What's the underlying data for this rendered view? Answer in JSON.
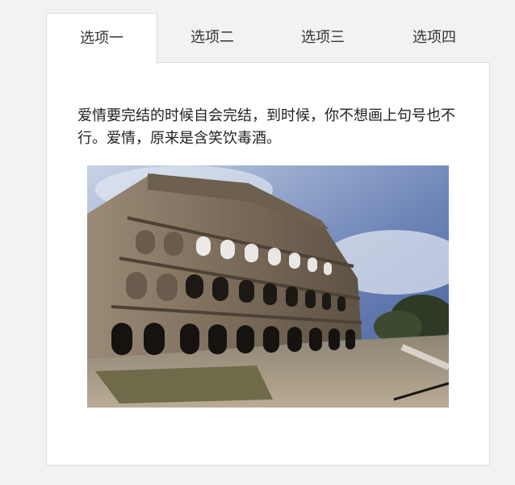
{
  "tabs": [
    {
      "label": "选项一",
      "active": true
    },
    {
      "label": "选项二",
      "active": false
    },
    {
      "label": "选项三",
      "active": false
    },
    {
      "label": "选项四",
      "active": false
    }
  ],
  "panel": {
    "text": "爱情要完结的时候自会完结，到时候，你不想画上句号也不行。爱情，原来是含笑饮毒酒。",
    "image_subject": "colosseum-photo"
  },
  "colors": {
    "page_background": "#f2f2f2",
    "panel_background": "#ffffff",
    "border": "#dcdcdc",
    "text": "#222222"
  }
}
